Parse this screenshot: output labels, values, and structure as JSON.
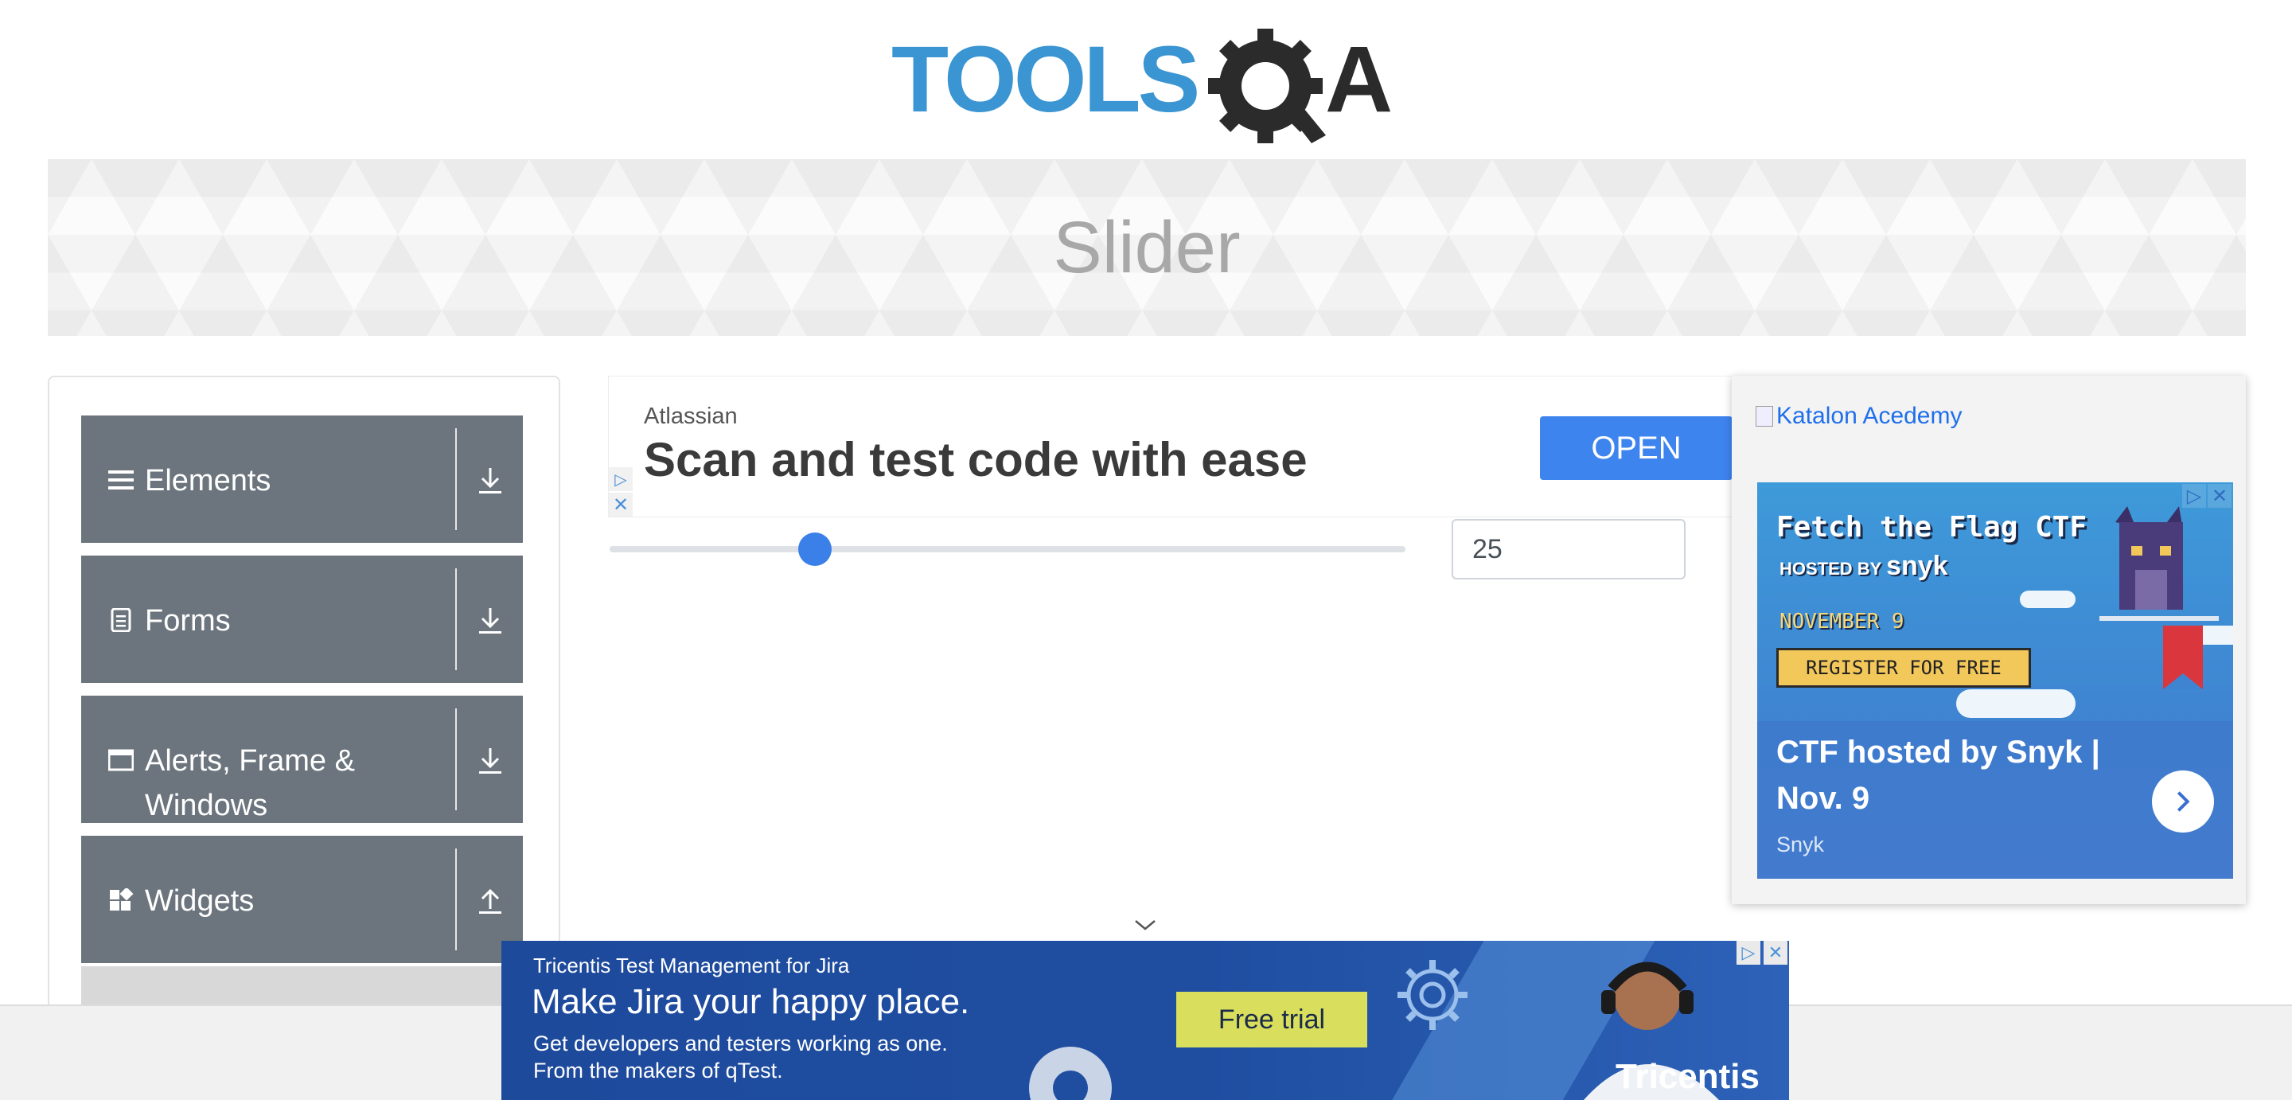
{
  "header": {
    "logo_text": "TOOLSQA",
    "page_title": "Slider"
  },
  "sidebar": {
    "groups": [
      {
        "label": "Elements",
        "icon": "hamburger-icon",
        "state": "collapsed"
      },
      {
        "label": "Forms",
        "icon": "document-icon",
        "state": "collapsed"
      },
      {
        "label": "Alerts, Frame & Windows",
        "icon": "window-icon",
        "state": "collapsed"
      },
      {
        "label": "Widgets",
        "icon": "widgets-icon",
        "state": "expanded"
      }
    ]
  },
  "top_ad": {
    "brand": "Atlassian",
    "headline": "Scan and test code with ease",
    "button_label": "OPEN"
  },
  "slider": {
    "min": 0,
    "max": 100,
    "value": 25,
    "value_text": "25",
    "accent_color": "#3b7fe9"
  },
  "right_ad": {
    "katalon_alt": "Katalon Acedemy",
    "title": "Fetch the Flag CTF",
    "hosted_by": "HOSTED BY",
    "host": "snyk",
    "date": "NOVEMBER 9",
    "register": "REGISTER FOR FREE",
    "headline": "CTF hosted by Snyk | Nov. 9",
    "advertiser": "Snyk"
  },
  "bottom_ad": {
    "kicker": "Tricentis Test Management for Jira",
    "headline": "Make Jira your happy place.",
    "sub_1": "Get developers and testers working as one.",
    "sub_2": "From the makers of qTest.",
    "cta": "Free trial",
    "brand": "Tricentis"
  }
}
